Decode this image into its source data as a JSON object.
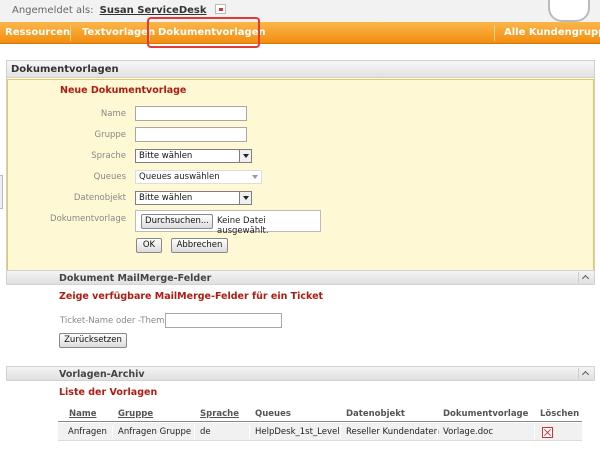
{
  "header": {
    "login_label": "Angemeldet als:",
    "user_name": "Susan ServiceDesk"
  },
  "nav": {
    "items": [
      "Ressourcen",
      "Textvorlagen",
      "Dokumentvorlagen"
    ],
    "right_item": "Alle Kundengruppen",
    "active": "Dokumentvorlagen"
  },
  "panel": {
    "title": "Dokumentvorlagen",
    "section_title": "Neue Dokumentvorlage",
    "fields": {
      "name_label": "Name",
      "name_value": "",
      "group_label": "Gruppe",
      "group_value": "",
      "language_label": "Sprache",
      "language_value": "Bitte wählen",
      "queues_label": "Queues",
      "queues_value": "Queues auswählen",
      "dataobject_label": "Datenobjekt",
      "dataobject_value": "Bitte wählen",
      "document_label": "Dokumentvorlage",
      "browse_label": "Durchsuchen...",
      "no_file_text": "Keine Datei ausgewählt."
    },
    "ok_label": "OK",
    "cancel_label": "Abbrechen"
  },
  "mailmerge": {
    "title": "Dokument MailMerge-Felder",
    "section_title": "Zeige verfügbare MailMerge-Felder für ein Ticket",
    "ticket_label": "Ticket-Name oder -Thema",
    "ticket_value": "",
    "reset_label": "Zurücksetzen"
  },
  "archive": {
    "title": "Vorlagen-Archiv",
    "section_title": "Liste der Vorlagen",
    "columns": [
      "Name",
      "Gruppe",
      "Sprache",
      "Queues",
      "Datenobjekt",
      "Dokumentvorlage",
      "Löschen"
    ],
    "rows": [
      [
        "Anfragen",
        "Anfragen Gruppe",
        "de",
        "HelpDesk_1st_Level",
        "Reseller Kundendaten",
        "Vorlage.doc"
      ]
    ]
  },
  "colors": {
    "nav_orange": "#f28e0f",
    "highlight_red": "#e53935",
    "section_title_red": "#b01c12",
    "form_background": "#fff8d4"
  }
}
